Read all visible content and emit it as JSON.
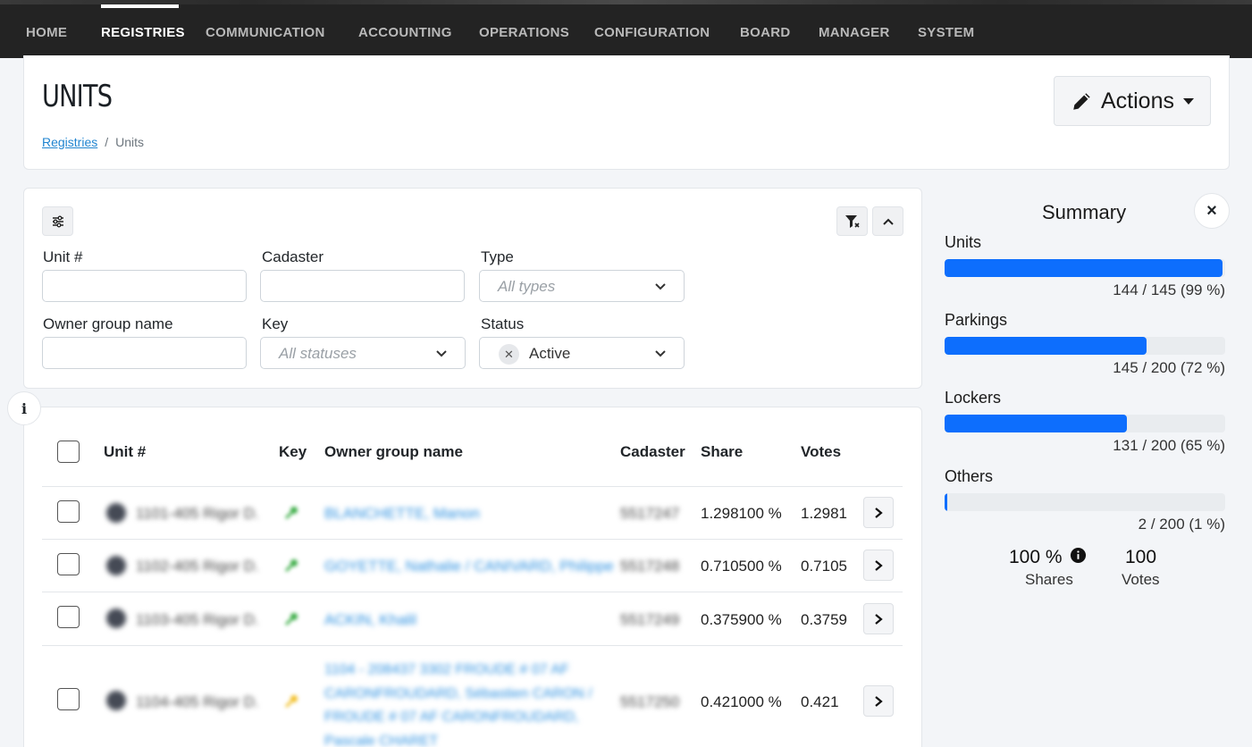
{
  "nav": {
    "items": [
      "HOME",
      "REGISTRIES",
      "COMMUNICATION",
      "ACCOUNTING",
      "OPERATIONS",
      "CONFIGURATION",
      "BOARD",
      "MANAGER",
      "SYSTEM"
    ],
    "active": "REGISTRIES"
  },
  "header": {
    "title": "UNITS",
    "breadcrumb": {
      "parent": "Registries",
      "separator": "/",
      "current": "Units"
    },
    "actions_label": "Actions"
  },
  "filters": {
    "unit_label": "Unit #",
    "cadaster_label": "Cadaster",
    "type_label": "Type",
    "type_placeholder": "All types",
    "owner_label": "Owner group name",
    "key_label": "Key",
    "key_placeholder": "All statuses",
    "status_label": "Status",
    "status_value": "Active"
  },
  "table": {
    "columns": [
      "Unit #",
      "Key",
      "Owner group name",
      "Cadaster",
      "Share",
      "Votes"
    ],
    "rows": [
      {
        "unit": "1101-405 Rigor D.",
        "key_color": "#3fae4a",
        "owner": "BLANCHETTE, Manon",
        "cadaster": "5517247",
        "share": "1.298100 %",
        "votes": "1.2981"
      },
      {
        "unit": "1102-405 Rigor D.",
        "key_color": "#3fae4a",
        "owner": "GOYETTE, Nathalie / CANIVARD, Philippe",
        "cadaster": "5517248",
        "share": "0.710500 %",
        "votes": "0.7105"
      },
      {
        "unit": "1103-405 Rigor D.",
        "key_color": "#3fae4a",
        "owner": "ACKIN, Khalil",
        "cadaster": "5517249",
        "share": "0.375900 %",
        "votes": "0.3759"
      },
      {
        "unit": "1104-405 Rigor D.",
        "key_color": "#f2c12e",
        "owner": "1104 - 208437 3302 FROUDE # 07 AF CARONFROUDARD, Sébastien CARON / FROUDE # 07 AF CARONFROUDARD, Pascale CHARET",
        "cadaster": "5517250",
        "share": "0.421000 %",
        "votes": "0.421"
      }
    ]
  },
  "summary": {
    "title": "Summary",
    "close_icon": "×",
    "items": [
      {
        "label": "Units",
        "count": "144 / 145 (99 %)",
        "fraction": 0.99
      },
      {
        "label": "Parkings",
        "count": "145 / 200 (72 %)",
        "fraction": 0.72
      },
      {
        "label": "Lockers",
        "count": "131 / 200 (65 %)",
        "fraction": 0.65
      },
      {
        "label": "Others",
        "count": "2 / 200 (1 %)",
        "fraction": 0.01
      }
    ],
    "shares_value": "100 %",
    "shares_label": "Shares",
    "votes_value": "100",
    "votes_label": "Votes"
  },
  "colors": {
    "accent": "#0d6efd",
    "nav_bg": "#232323",
    "link": "#2185d0"
  }
}
